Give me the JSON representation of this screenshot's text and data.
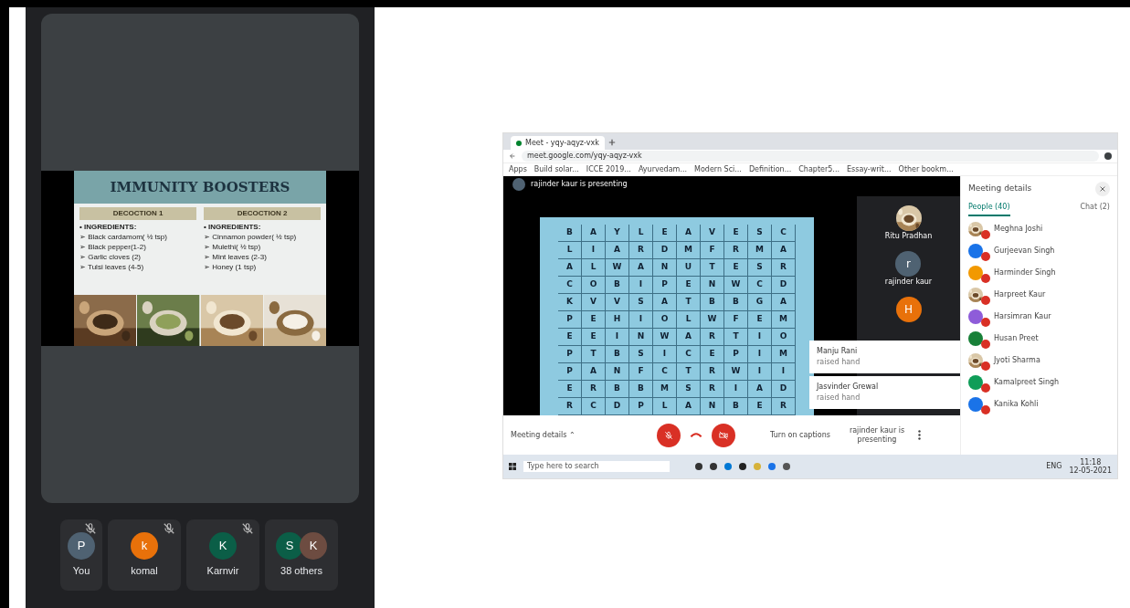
{
  "left_call": {
    "slide": {
      "title": "IMMUNITY BOOSTERS",
      "columns": [
        {
          "heading": "DECOCTION 1",
          "label": "• INGREDIENTS:",
          "items": [
            "➢ Black cardamom( ½ tsp)",
            "➢ Black pepper(1-2)",
            "➢ Garlic cloves (2)",
            "➢ Tulsi leaves (4-5)"
          ]
        },
        {
          "heading": "DECOCTION 2",
          "label": "• INGREDIENTS:",
          "items": [
            "➢ Cinnamon powder( ½ tsp)",
            "➢ Mulethi( ½ tsp)",
            "➢ Mint leaves (2-3)",
            "➢ Honey (1 tsp)"
          ]
        }
      ]
    },
    "participants": [
      {
        "name": "You",
        "avatars": [
          {
            "letter": "P",
            "color": "#4f6272"
          }
        ],
        "muted": true
      },
      {
        "name": "komal",
        "avatars": [
          {
            "letter": "k",
            "color": "#e8710a"
          }
        ],
        "muted": true
      },
      {
        "name": "Karnvir",
        "avatars": [
          {
            "letter": "K",
            "color": "#0b5e47"
          }
        ],
        "muted": true
      },
      {
        "name": "38 others",
        "avatars": [
          {
            "letter": "S",
            "color": "#0b5e47"
          },
          {
            "letter": "K",
            "color": "#6d4c41"
          }
        ],
        "muted": false
      }
    ]
  },
  "browser": {
    "tab": "Meet - yqy-aqyz-vxk",
    "url": "meet.google.com/yqy-aqyz-vxk",
    "bookmarks": [
      "Apps",
      "Build solar...",
      "ICCE 2019...",
      "Ayurvedam...",
      "Modern Sci...",
      "Definition...",
      "Chapter5...",
      "Essay-writ...",
      "Other bookm..."
    ]
  },
  "meet": {
    "presenting": "rajinder kaur is presenting",
    "grid": [
      [
        "B",
        "A",
        "Y",
        "L",
        "E",
        "A",
        "V",
        "E",
        "S",
        "C"
      ],
      [
        "L",
        "I",
        "A",
        "R",
        "D",
        "M",
        "F",
        "R",
        "M",
        "A"
      ],
      [
        "A",
        "L",
        "W",
        "A",
        "N",
        "U",
        "T",
        "E",
        "S",
        "R"
      ],
      [
        "C",
        "O",
        "B",
        "I",
        "P",
        "E",
        "N",
        "W",
        "C",
        "D"
      ],
      [
        "K",
        "V",
        "V",
        "S",
        "A",
        "T",
        "B",
        "B",
        "G",
        "A"
      ],
      [
        "P",
        "E",
        "H",
        "I",
        "O",
        "L",
        "W",
        "F",
        "E",
        "M"
      ],
      [
        "E",
        "E",
        "I",
        "N",
        "W",
        "A",
        "R",
        "T",
        "I",
        "O"
      ],
      [
        "P",
        "T",
        "B",
        "S",
        "I",
        "C",
        "E",
        "P",
        "I",
        "M"
      ],
      [
        "P",
        "A",
        "N",
        "F",
        "C",
        "T",
        "R",
        "W",
        "I",
        "I"
      ],
      [
        "E",
        "R",
        "B",
        "B",
        "M",
        "S",
        "R",
        "I",
        "A",
        "D"
      ],
      [
        "R",
        "C",
        "D",
        "P",
        "L",
        "A",
        "N",
        "B",
        "E",
        "R"
      ]
    ],
    "tiles": [
      {
        "name": "Ritu Pradhan",
        "kind": "picture"
      },
      {
        "name": "rajinder kaur",
        "kind": "letter",
        "letter": "r",
        "color": "#4f6272"
      },
      {
        "kind": "letter",
        "letter": "H",
        "color": "#e8710a"
      }
    ],
    "notifications": [
      {
        "name": "Manju Rani",
        "note": "raised hand"
      },
      {
        "name": "Jasvinder Grewal",
        "note": "raised hand"
      }
    ],
    "bar": {
      "details": "Meeting details ⌃",
      "captions": "Turn on captions",
      "presenter": "rajinder kaur is presenting"
    },
    "panel": {
      "title": "Meeting details",
      "tabs": [
        {
          "label": "People (40)",
          "selected": true
        },
        {
          "label": "Chat (2)",
          "selected": false
        }
      ],
      "people": [
        {
          "name": "Meghna Joshi",
          "kind": "picture"
        },
        {
          "name": "Gurjeevan Singh",
          "kind": "letter",
          "color": "#1a73e8"
        },
        {
          "name": "Harminder Singh",
          "kind": "letter",
          "color": "#f29900"
        },
        {
          "name": "Harpreet Kaur",
          "kind": "picture"
        },
        {
          "name": "Harsimran Kaur",
          "kind": "letter",
          "color": "#8e5cd9"
        },
        {
          "name": "Husan Preet",
          "kind": "letter",
          "color": "#188038"
        },
        {
          "name": "Jyoti Sharma",
          "kind": "picture"
        },
        {
          "name": "Kamalpreet Singh",
          "kind": "letter",
          "color": "#0f9d58"
        },
        {
          "name": "Kanika Kohli",
          "kind": "letter",
          "color": "#1a73e8"
        }
      ]
    }
  },
  "taskbar": {
    "search": "Type here to search",
    "lang": "ENG",
    "time": "11:18",
    "date": "12-05-2021"
  }
}
